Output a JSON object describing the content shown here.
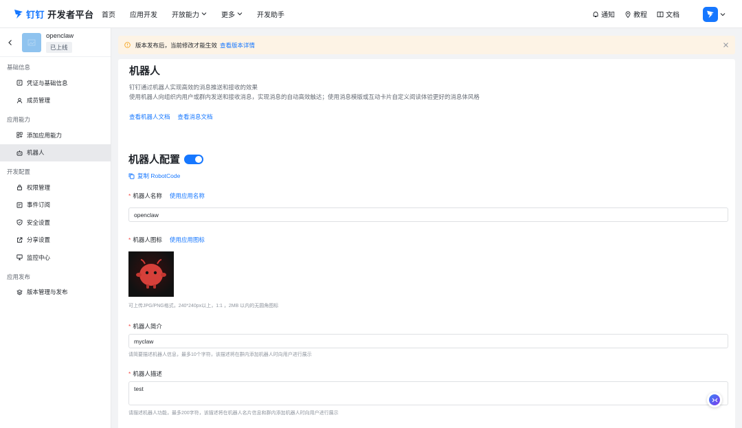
{
  "topnav": {
    "brand": "钉钉",
    "product": "开发者平台",
    "links": [
      {
        "label": "首页",
        "dropdown": false
      },
      {
        "label": "应用开发",
        "dropdown": false
      },
      {
        "label": "开放能力",
        "dropdown": true
      },
      {
        "label": "更多",
        "dropdown": true
      },
      {
        "label": "开发助手",
        "dropdown": false
      }
    ],
    "tools": [
      {
        "icon": "bell-icon",
        "label": "通知"
      },
      {
        "icon": "map-pin-icon",
        "label": "教程"
      },
      {
        "icon": "book-icon",
        "label": "文档"
      }
    ]
  },
  "sidebar": {
    "app_name": "openclaw",
    "app_status": "已上线",
    "groups": [
      {
        "title": "基础信息",
        "items": [
          {
            "label": "凭证与基础信息",
            "icon": "credential-icon"
          },
          {
            "label": "成员管理",
            "icon": "user-icon"
          }
        ]
      },
      {
        "title": "应用能力",
        "items": [
          {
            "label": "添加应用能力",
            "icon": "add-capability-icon"
          },
          {
            "label": "机器人",
            "icon": "robot-icon",
            "active": true
          }
        ]
      },
      {
        "title": "开发配置",
        "items": [
          {
            "label": "权限管理",
            "icon": "lock-icon"
          },
          {
            "label": "事件订阅",
            "icon": "event-icon"
          },
          {
            "label": "安全设置",
            "icon": "shield-icon"
          },
          {
            "label": "分享设置",
            "icon": "share-icon"
          },
          {
            "label": "监控中心",
            "icon": "monitor-icon"
          }
        ]
      },
      {
        "title": "应用发布",
        "items": [
          {
            "label": "版本管理与发布",
            "icon": "layers-icon"
          }
        ]
      }
    ]
  },
  "banner": {
    "text": "版本发布后，当前修改才能生效",
    "link": "查看版本详情"
  },
  "intro": {
    "title": "机器人",
    "line1": "钉钉通过机器人实现高效的消息推送和接收的效果",
    "line2": "使用机器人向组织内用户或群内发送和接收消息，实现消息的自动高效触达；使用消息模版或互动卡片自定义阅读体验更好的消息体风格",
    "link1": "查看机器人文档",
    "link2": "查看消息文档"
  },
  "config": {
    "title": "机器人配置",
    "enabled": true,
    "copy_label": "复制 RobotCode",
    "name_label": "机器人名称",
    "name_link": "使用应用名称",
    "name_value": "openclaw",
    "icon_label": "机器人图标",
    "icon_link": "使用应用图标",
    "icon_hint": "可上传JPG/PNG格式，240*240px以上，1:1 ，2MB 以内的无圆角图标",
    "brief_label": "机器人简介",
    "brief_value": "myclaw",
    "brief_hint": "请简要描述机器人信息，最多10个字符，该描述将在群内添加机器人时向用户进行展示",
    "desc_label": "机器人描述",
    "desc_value": "test",
    "desc_hint": "请描述机器人功能，最多200字符，该描述将在机器人名片信息和群内添加机器人时向用户进行展示"
  }
}
